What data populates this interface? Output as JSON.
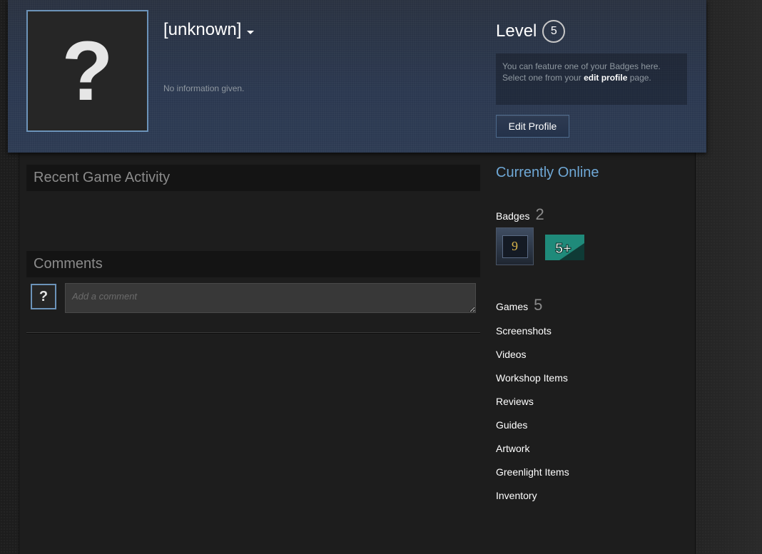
{
  "profile": {
    "persona_name": "[unknown]",
    "summary": "No information given.",
    "level_label": "Level",
    "level_value": "5",
    "avatar_glyph": "?"
  },
  "featured_badge": {
    "text_pre": "You can feature one of your Badges here. Select one from your ",
    "link": "edit profile",
    "text_post": " page."
  },
  "buttons": {
    "edit_profile": "Edit Profile"
  },
  "sections": {
    "recent_activity": "Recent Game Activity",
    "comments": "Comments"
  },
  "comment_box": {
    "placeholder": "Add a comment",
    "avatar_glyph": "?"
  },
  "sidebar": {
    "status": "Currently Online",
    "badges_label": "Badges",
    "badges_count": "2",
    "badges": [
      {
        "name": "badge-level-9",
        "text": "9"
      },
      {
        "name": "badge-years-5plus",
        "text": "5+"
      }
    ],
    "games_label": "Games",
    "games_count": "5",
    "links": [
      "Screenshots",
      "Videos",
      "Workshop Items",
      "Reviews",
      "Guides",
      "Artwork",
      "Greenlight Items",
      "Inventory"
    ]
  },
  "colors": {
    "accent_blue": "#6fa8d6",
    "avatar_border": "#6c93b9",
    "header_bg": "#2b3850",
    "badge_teal": "#1f8a7a"
  }
}
